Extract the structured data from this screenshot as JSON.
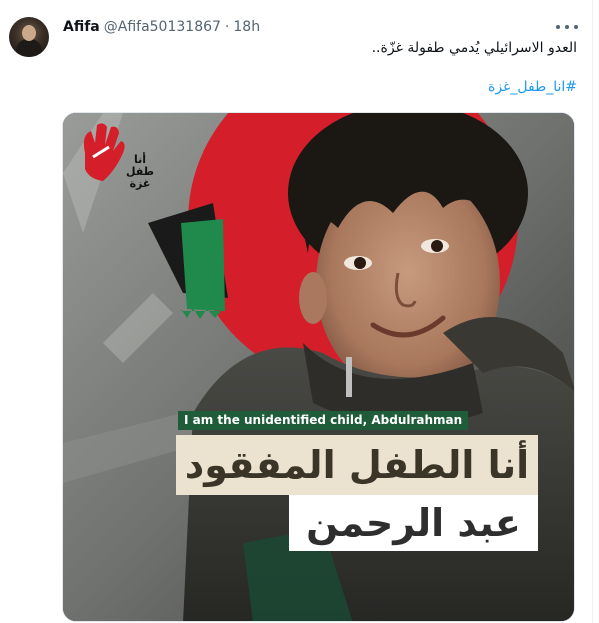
{
  "tweet": {
    "display_name": "Afifa",
    "handle": "@Afifa50131867",
    "separator": "·",
    "time": "18h",
    "text": "العدو الاسرائيلي يُدمي طفولة غزّة..",
    "hashtag": "#انا_طفل_غزة"
  },
  "media": {
    "logo_text": "أنا طفل غزة",
    "caption_english": "I am the unidentified child, Abdulrahman",
    "caption_arabic_line1": "أنا الطفل المفقود",
    "caption_arabic_line2": "عبد الرحمن"
  },
  "colors": {
    "link": "#1d9bf0",
    "text_primary": "#0f1419",
    "text_secondary": "#536471",
    "circle_red": "#d41f2a",
    "flag_green": "#1f8a4c",
    "caption_green": "#1f5c3a"
  }
}
